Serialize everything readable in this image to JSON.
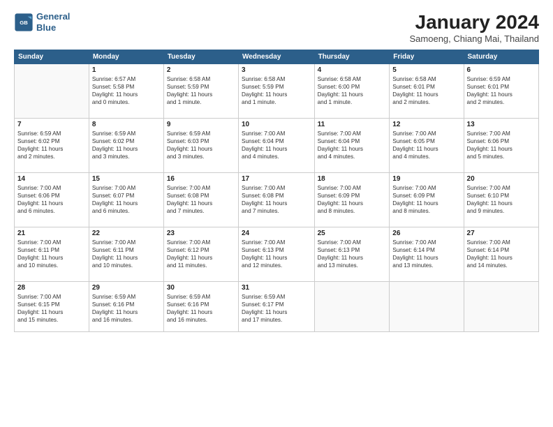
{
  "header": {
    "logo_line1": "General",
    "logo_line2": "Blue",
    "month_title": "January 2024",
    "subtitle": "Samoeng, Chiang Mai, Thailand"
  },
  "days_of_week": [
    "Sunday",
    "Monday",
    "Tuesday",
    "Wednesday",
    "Thursday",
    "Friday",
    "Saturday"
  ],
  "weeks": [
    [
      {
        "day": "",
        "info": ""
      },
      {
        "day": "1",
        "info": "Sunrise: 6:57 AM\nSunset: 5:58 PM\nDaylight: 11 hours\nand 0 minutes."
      },
      {
        "day": "2",
        "info": "Sunrise: 6:58 AM\nSunset: 5:59 PM\nDaylight: 11 hours\nand 1 minute."
      },
      {
        "day": "3",
        "info": "Sunrise: 6:58 AM\nSunset: 5:59 PM\nDaylight: 11 hours\nand 1 minute."
      },
      {
        "day": "4",
        "info": "Sunrise: 6:58 AM\nSunset: 6:00 PM\nDaylight: 11 hours\nand 1 minute."
      },
      {
        "day": "5",
        "info": "Sunrise: 6:58 AM\nSunset: 6:01 PM\nDaylight: 11 hours\nand 2 minutes."
      },
      {
        "day": "6",
        "info": "Sunrise: 6:59 AM\nSunset: 6:01 PM\nDaylight: 11 hours\nand 2 minutes."
      }
    ],
    [
      {
        "day": "7",
        "info": "Sunrise: 6:59 AM\nSunset: 6:02 PM\nDaylight: 11 hours\nand 2 minutes."
      },
      {
        "day": "8",
        "info": "Sunrise: 6:59 AM\nSunset: 6:02 PM\nDaylight: 11 hours\nand 3 minutes."
      },
      {
        "day": "9",
        "info": "Sunrise: 6:59 AM\nSunset: 6:03 PM\nDaylight: 11 hours\nand 3 minutes."
      },
      {
        "day": "10",
        "info": "Sunrise: 7:00 AM\nSunset: 6:04 PM\nDaylight: 11 hours\nand 4 minutes."
      },
      {
        "day": "11",
        "info": "Sunrise: 7:00 AM\nSunset: 6:04 PM\nDaylight: 11 hours\nand 4 minutes."
      },
      {
        "day": "12",
        "info": "Sunrise: 7:00 AM\nSunset: 6:05 PM\nDaylight: 11 hours\nand 4 minutes."
      },
      {
        "day": "13",
        "info": "Sunrise: 7:00 AM\nSunset: 6:06 PM\nDaylight: 11 hours\nand 5 minutes."
      }
    ],
    [
      {
        "day": "14",
        "info": "Sunrise: 7:00 AM\nSunset: 6:06 PM\nDaylight: 11 hours\nand 6 minutes."
      },
      {
        "day": "15",
        "info": "Sunrise: 7:00 AM\nSunset: 6:07 PM\nDaylight: 11 hours\nand 6 minutes."
      },
      {
        "day": "16",
        "info": "Sunrise: 7:00 AM\nSunset: 6:08 PM\nDaylight: 11 hours\nand 7 minutes."
      },
      {
        "day": "17",
        "info": "Sunrise: 7:00 AM\nSunset: 6:08 PM\nDaylight: 11 hours\nand 7 minutes."
      },
      {
        "day": "18",
        "info": "Sunrise: 7:00 AM\nSunset: 6:09 PM\nDaylight: 11 hours\nand 8 minutes."
      },
      {
        "day": "19",
        "info": "Sunrise: 7:00 AM\nSunset: 6:09 PM\nDaylight: 11 hours\nand 8 minutes."
      },
      {
        "day": "20",
        "info": "Sunrise: 7:00 AM\nSunset: 6:10 PM\nDaylight: 11 hours\nand 9 minutes."
      }
    ],
    [
      {
        "day": "21",
        "info": "Sunrise: 7:00 AM\nSunset: 6:11 PM\nDaylight: 11 hours\nand 10 minutes."
      },
      {
        "day": "22",
        "info": "Sunrise: 7:00 AM\nSunset: 6:11 PM\nDaylight: 11 hours\nand 10 minutes."
      },
      {
        "day": "23",
        "info": "Sunrise: 7:00 AM\nSunset: 6:12 PM\nDaylight: 11 hours\nand 11 minutes."
      },
      {
        "day": "24",
        "info": "Sunrise: 7:00 AM\nSunset: 6:13 PM\nDaylight: 11 hours\nand 12 minutes."
      },
      {
        "day": "25",
        "info": "Sunrise: 7:00 AM\nSunset: 6:13 PM\nDaylight: 11 hours\nand 13 minutes."
      },
      {
        "day": "26",
        "info": "Sunrise: 7:00 AM\nSunset: 6:14 PM\nDaylight: 11 hours\nand 13 minutes."
      },
      {
        "day": "27",
        "info": "Sunrise: 7:00 AM\nSunset: 6:14 PM\nDaylight: 11 hours\nand 14 minutes."
      }
    ],
    [
      {
        "day": "28",
        "info": "Sunrise: 7:00 AM\nSunset: 6:15 PM\nDaylight: 11 hours\nand 15 minutes."
      },
      {
        "day": "29",
        "info": "Sunrise: 6:59 AM\nSunset: 6:16 PM\nDaylight: 11 hours\nand 16 minutes."
      },
      {
        "day": "30",
        "info": "Sunrise: 6:59 AM\nSunset: 6:16 PM\nDaylight: 11 hours\nand 16 minutes."
      },
      {
        "day": "31",
        "info": "Sunrise: 6:59 AM\nSunset: 6:17 PM\nDaylight: 11 hours\nand 17 minutes."
      },
      {
        "day": "",
        "info": ""
      },
      {
        "day": "",
        "info": ""
      },
      {
        "day": "",
        "info": ""
      }
    ]
  ]
}
